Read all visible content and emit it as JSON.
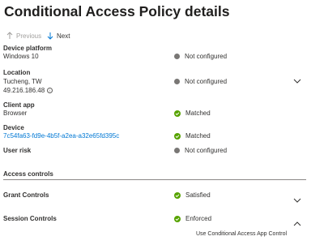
{
  "header": {
    "title": "Conditional Access Policy details"
  },
  "nav": {
    "previous_label": "Previous",
    "next_label": "Next"
  },
  "rows": {
    "device_platform": {
      "label": "Device platform",
      "value": "Windows 10",
      "status": "Not configured"
    },
    "location": {
      "label": "Location",
      "value": "Tucheng, TW",
      "ip": "49.216.186.48",
      "status": "Not configured"
    },
    "client_app": {
      "label": "Client app",
      "value": "Browser",
      "status": "Matched"
    },
    "device": {
      "label": "Device",
      "value": "7c54fa63-fd9e-4b5f-a2ea-a32e65fd395c",
      "status": "Matched"
    },
    "user_risk": {
      "label": "User risk",
      "status": "Not configured"
    }
  },
  "access_controls": {
    "heading": "Access controls",
    "grant": {
      "label": "Grant Controls",
      "status": "Satisfied"
    },
    "session": {
      "label": "Session Controls",
      "status": "Enforced",
      "detail": "Use Conditional Access App Control"
    }
  },
  "colors": {
    "matched": "#57a300",
    "not_configured": "#797775",
    "link": "#0078d4"
  }
}
